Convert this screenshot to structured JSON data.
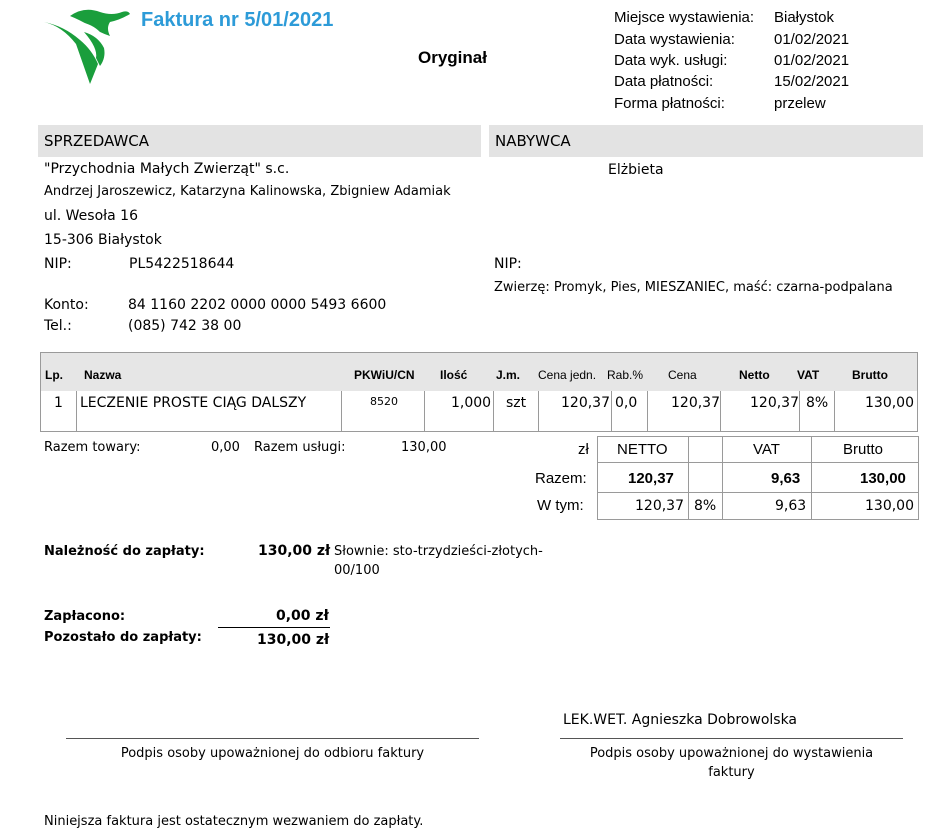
{
  "invoice": {
    "title": "Faktura nr 5/01/2021",
    "copy_label": "Oryginał"
  },
  "meta": [
    {
      "label": "Miejsce wystawienia:",
      "value": "Białystok"
    },
    {
      "label": "Data wystawienia:",
      "value": "01/02/2021"
    },
    {
      "label": "Data wyk. usługi:",
      "value": "01/02/2021"
    },
    {
      "label": "Data płatności:",
      "value": "15/02/2021"
    },
    {
      "label": "Forma płatności:",
      "value": "przelew"
    }
  ],
  "seller": {
    "heading": "SPRZEDAWCA",
    "name": "\"Przychodnia Małych Zwierząt\" s.c.",
    "owners": "Andrzej Jaroszewicz, Katarzyna Kalinowska, Zbigniew Adamiak",
    "street": "ul. Wesoła 16",
    "city": "15-306 Białystok",
    "nip_label": "NIP:",
    "nip": "PL5422518644",
    "account_label": "Konto:",
    "account": "84 1160 2202 0000 0000 5493 6600",
    "phone_label": "Tel.:",
    "phone": "(085) 742 38 00"
  },
  "buyer": {
    "heading": "NABYWCA",
    "name": "Elżbieta",
    "nip_label": "NIP:",
    "animals": "Zwierzę: Promyk, Pies, MIESZANIEC, maść: czarna-podpalana"
  },
  "items_table": {
    "headers": {
      "lp": "Lp.",
      "name": "Nazwa",
      "pkwiu": "PKWiU/CN",
      "qty": "Ilość",
      "unit": "J.m.",
      "unit_price": "Cena jedn.",
      "discount": "Rab.%",
      "price": "Cena",
      "net": "Netto",
      "vat": "VAT",
      "gross": "Brutto"
    },
    "rows": [
      {
        "lp": "1",
        "name": "LECZENIE PROSTE CIĄG DALSZY",
        "pkwiu": "8520",
        "qty": "1,000",
        "unit": "szt",
        "unit_price": "120,37",
        "discount": "0,0",
        "price": "120,37",
        "net": "120,37",
        "vat": "8%",
        "gross": "130,00"
      }
    ]
  },
  "subtotals": {
    "goods_label": "Razem towary:",
    "goods": "0,00",
    "services_label": "Razem usługi:",
    "services": "130,00"
  },
  "summary": {
    "currency": "zł",
    "headers": {
      "net": "NETTO",
      "vat": "VAT",
      "gross": "Brutto"
    },
    "total_label": "Razem:",
    "total": {
      "net": "120,37",
      "vat": "9,63",
      "gross": "130,00"
    },
    "incl_label": "W tym:",
    "incl": {
      "net": "120,37",
      "rate": "8%",
      "vat": "9,63",
      "gross": "130,00"
    }
  },
  "payment": {
    "due_label": "Należność do zapłaty:",
    "due": "130,00 zł",
    "words_line1": "Słownie: sto-trzydzieści-złotych-",
    "words_line2": "00/100",
    "paid_label": "Zapłacono:",
    "paid": "0,00 zł",
    "remaining_label": "Pozostało do zapłaty:",
    "remaining": "130,00 zł"
  },
  "signatures": {
    "issuer_name": "LEK.WET. Agnieszka Dobrowolska",
    "receiver_caption": "Podpis osoby upoważnionej do odbioru faktury",
    "issuer_caption_line1": "Podpis osoby upoważnionej do wystawienia",
    "issuer_caption_line2": "faktury"
  },
  "footer": {
    "note": "Niniejsza faktura jest ostatecznym wezwaniem do zapłaty."
  },
  "colors": {
    "title": "#2d9bd8",
    "logo_green": "#1a9e3c",
    "header_bar": "#e3e3e3"
  }
}
